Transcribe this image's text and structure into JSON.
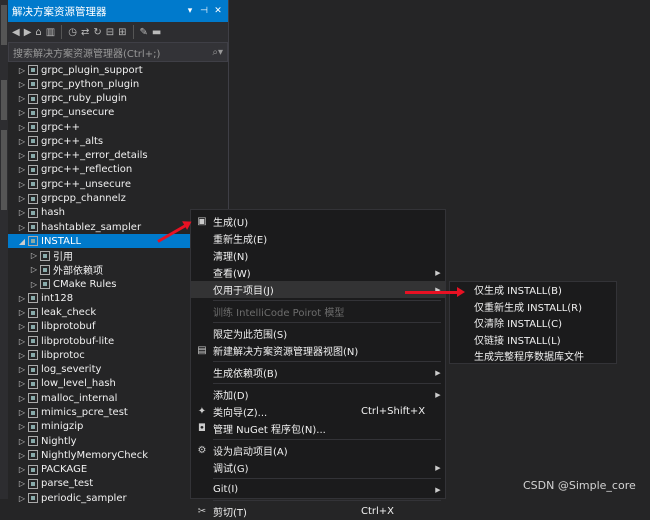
{
  "panel": {
    "title": "解决方案资源管理器",
    "search_placeholder": "搜索解决方案资源管理器(Ctrl+;)"
  },
  "tree": [
    {
      "label": "grpc_plugin_support",
      "type": "project"
    },
    {
      "label": "grpc_python_plugin",
      "type": "project"
    },
    {
      "label": "grpc_ruby_plugin",
      "type": "project"
    },
    {
      "label": "grpc_unsecure",
      "type": "project"
    },
    {
      "label": "grpc++",
      "type": "project"
    },
    {
      "label": "grpc++_alts",
      "type": "project"
    },
    {
      "label": "grpc++_error_details",
      "type": "project"
    },
    {
      "label": "grpc++_reflection",
      "type": "project"
    },
    {
      "label": "grpc++_unsecure",
      "type": "project"
    },
    {
      "label": "grpcpp_channelz",
      "type": "project"
    },
    {
      "label": "hash",
      "type": "project"
    },
    {
      "label": "hashtablez_sampler",
      "type": "project"
    },
    {
      "label": "INSTALL",
      "type": "project",
      "expanded": true,
      "selected": true
    },
    {
      "label": "引用",
      "type": "child"
    },
    {
      "label": "外部依赖项",
      "type": "child"
    },
    {
      "label": "CMake Rules",
      "type": "child"
    },
    {
      "label": "int128",
      "type": "project"
    },
    {
      "label": "leak_check",
      "type": "project"
    },
    {
      "label": "libprotobuf",
      "type": "project"
    },
    {
      "label": "libprotobuf-lite",
      "type": "project"
    },
    {
      "label": "libprotoc",
      "type": "project"
    },
    {
      "label": "log_severity",
      "type": "project"
    },
    {
      "label": "low_level_hash",
      "type": "project"
    },
    {
      "label": "malloc_internal",
      "type": "project"
    },
    {
      "label": "mimics_pcre_test",
      "type": "project"
    },
    {
      "label": "minigzip",
      "type": "project"
    },
    {
      "label": "Nightly",
      "type": "project"
    },
    {
      "label": "NightlyMemoryCheck",
      "type": "project"
    },
    {
      "label": "PACKAGE",
      "type": "project"
    },
    {
      "label": "parse_test",
      "type": "project"
    },
    {
      "label": "periodic_sampler",
      "type": "project"
    }
  ],
  "context_menu": [
    {
      "label": "生成(U)",
      "icon": "build-icon",
      "name": "build"
    },
    {
      "label": "重新生成(E)",
      "name": "rebuild"
    },
    {
      "label": "清理(N)",
      "name": "clean"
    },
    {
      "label": "查看(W)",
      "name": "view",
      "submenu": true
    },
    {
      "label": "仅用于项目(J)",
      "name": "project-only",
      "submenu": true,
      "highlighted": true
    },
    {
      "sep": true
    },
    {
      "label": "训练 IntelliCode Poirot 模型",
      "name": "intellicode",
      "disabled": true
    },
    {
      "sep": true
    },
    {
      "label": "限定为此范围(S)",
      "name": "scope"
    },
    {
      "label": "新建解决方案资源管理器视图(N)",
      "icon": "new-view-icon",
      "name": "new-view"
    },
    {
      "sep": true
    },
    {
      "label": "生成依赖项(B)",
      "name": "build-deps",
      "submenu": true
    },
    {
      "sep": true
    },
    {
      "label": "添加(D)",
      "name": "add",
      "submenu": true
    },
    {
      "label": "类向导(Z)...",
      "icon": "class-wizard-icon",
      "shortcut": "Ctrl+Shift+X",
      "name": "class-wizard"
    },
    {
      "label": "管理 NuGet 程序包(N)...",
      "icon": "nuget-icon",
      "name": "nuget"
    },
    {
      "sep": true
    },
    {
      "label": "设为启动项目(A)",
      "icon": "gear-icon",
      "name": "startup"
    },
    {
      "label": "调试(G)",
      "name": "debug",
      "submenu": true
    },
    {
      "sep": true
    },
    {
      "label": "Git(I)",
      "name": "git",
      "submenu": true
    },
    {
      "sep": true
    },
    {
      "label": "剪切(T)",
      "icon": "cut-icon",
      "shortcut": "Ctrl+X",
      "name": "cut"
    }
  ],
  "submenu": [
    {
      "label": "仅生成 INSTALL(B)",
      "name": "build-only"
    },
    {
      "label": "仅重新生成 INSTALL(R)",
      "name": "rebuild-only"
    },
    {
      "label": "仅清除 INSTALL(C)",
      "name": "clean-only"
    },
    {
      "label": "仅链接 INSTALL(L)",
      "name": "link-only"
    },
    {
      "label": "生成完整程序数据库文件",
      "name": "full-pdb"
    }
  ],
  "watermark": "CSDN @Simple_core",
  "colors": {
    "accent": "#007acc",
    "annotation_arrow": "#e81123",
    "menu_bg": "#1b1b1c"
  }
}
